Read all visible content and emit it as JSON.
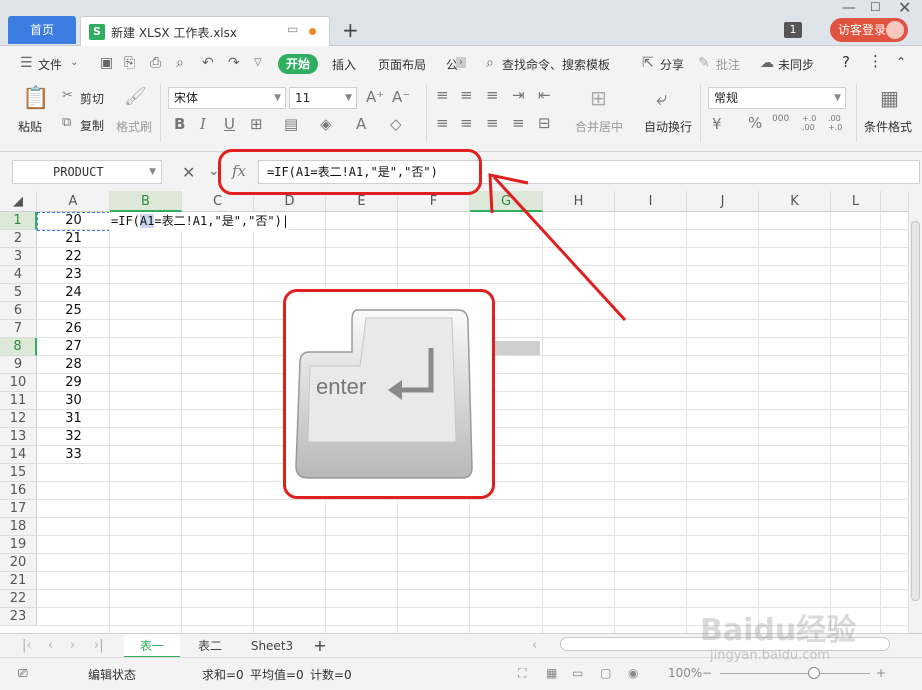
{
  "titlebar": {
    "home_tab": "首页",
    "doc_tab_title": "新建 XLSX 工作表.xlsx",
    "doc_tab_icon": "S",
    "new_tab": "+",
    "window_count": "1",
    "login_label": "访客登录"
  },
  "menu": {
    "file": "文件",
    "start": "开始",
    "insert": "插入",
    "page_layout": "页面布局",
    "more": "公",
    "search": "查找命令、搜索模板",
    "share": "分享",
    "comment": "批注",
    "sync": "未同步",
    "help": "?"
  },
  "ribbon": {
    "paste": "粘贴",
    "cut": "剪切",
    "copy": "复制",
    "format_painter": "格式刷",
    "font_name": "宋体",
    "font_size": "11",
    "merge_center": "合并居中",
    "wrap_text": "自动换行",
    "number_format": "常规",
    "conditional_format": "条件格式",
    "percent": "%",
    "thousands": "000",
    "inc_decimal": "+.0\n.00",
    "dec_decimal": ".00\n+.0"
  },
  "formula_bar": {
    "name_box": "PRODUCT",
    "fx": "fx",
    "formula": "=IF(A1=表二!A1,\"是\",\"否\")"
  },
  "columns": [
    "A",
    "B",
    "C",
    "D",
    "E",
    "F",
    "G",
    "H",
    "I",
    "J",
    "K",
    "L"
  ],
  "rows": [
    "1",
    "2",
    "3",
    "4",
    "5",
    "6",
    "7",
    "8",
    "9",
    "10",
    "11",
    "12",
    "13",
    "14",
    "15",
    "16",
    "17",
    "18",
    "19",
    "20",
    "21",
    "22",
    "23"
  ],
  "column_a_values": [
    "20",
    "21",
    "22",
    "23",
    "24",
    "25",
    "26",
    "27",
    "28",
    "29",
    "30",
    "31",
    "32",
    "33"
  ],
  "edit_cell": {
    "prefix": "=IF(",
    "ref": "A1",
    "suffix": "=表二!A1,\"是\",\"否\")"
  },
  "annotation": {
    "key_label": "enter",
    "key_arrow": "↵"
  },
  "sheets": {
    "tabs": [
      "表一",
      "表二",
      "Sheet3"
    ],
    "active": "表一",
    "add": "+"
  },
  "status": {
    "mode": "编辑状态",
    "sum": "求和=0",
    "average": "平均值=0",
    "count": "计数=0",
    "zoom": "100%"
  },
  "watermark": {
    "brand": "Baidu经验",
    "url": "jingyan.baidu.com"
  },
  "colors": {
    "accent_green": "#2eae5e",
    "tab_blue": "#3b7de0",
    "login_red": "#e0533f",
    "annotation_red": "#e02020"
  }
}
